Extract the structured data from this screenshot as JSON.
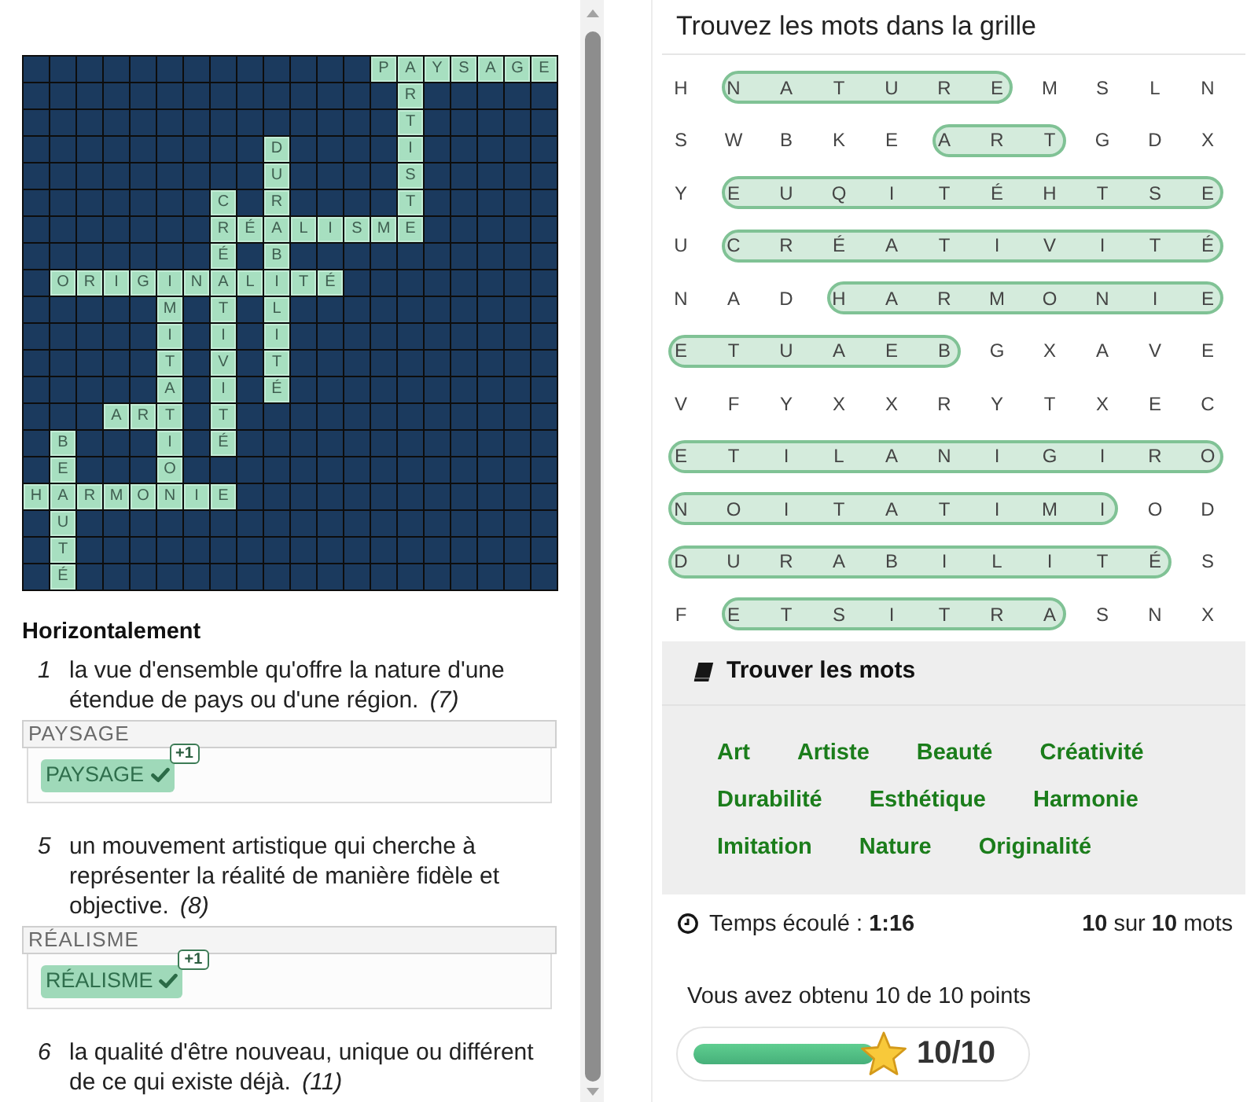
{
  "crossword": {
    "rows": [
      [
        null,
        null,
        null,
        null,
        null,
        null,
        null,
        null,
        null,
        null,
        null,
        null,
        null,
        "P",
        "A",
        "Y",
        "S",
        "A",
        "G",
        "E"
      ],
      [
        null,
        null,
        null,
        null,
        null,
        null,
        null,
        null,
        null,
        null,
        null,
        null,
        null,
        null,
        "R",
        null,
        null,
        null,
        null,
        null
      ],
      [
        null,
        null,
        null,
        null,
        null,
        null,
        null,
        null,
        null,
        null,
        null,
        null,
        null,
        null,
        "T",
        null,
        null,
        null,
        null,
        null
      ],
      [
        null,
        null,
        null,
        null,
        null,
        null,
        null,
        null,
        null,
        "D",
        null,
        null,
        null,
        null,
        "I",
        null,
        null,
        null,
        null,
        null
      ],
      [
        null,
        null,
        null,
        null,
        null,
        null,
        null,
        null,
        null,
        "U",
        null,
        null,
        null,
        null,
        "S",
        null,
        null,
        null,
        null,
        null
      ],
      [
        null,
        null,
        null,
        null,
        null,
        null,
        null,
        "C",
        null,
        "R",
        null,
        null,
        null,
        null,
        "T",
        null,
        null,
        null,
        null,
        null
      ],
      [
        null,
        null,
        null,
        null,
        null,
        null,
        null,
        "R",
        "É",
        "A",
        "L",
        "I",
        "S",
        "M",
        "E",
        null,
        null,
        null,
        null,
        null
      ],
      [
        null,
        null,
        null,
        null,
        null,
        null,
        null,
        "É",
        null,
        "B",
        null,
        null,
        null,
        null,
        null,
        null,
        null,
        null,
        null,
        null
      ],
      [
        null,
        "O",
        "R",
        "I",
        "G",
        "I",
        "N",
        "A",
        "L",
        "I",
        "T",
        "É",
        null,
        null,
        null,
        null,
        null,
        null,
        null,
        null
      ],
      [
        null,
        null,
        null,
        null,
        null,
        "M",
        null,
        "T",
        null,
        "L",
        null,
        null,
        null,
        null,
        null,
        null,
        null,
        null,
        null,
        null
      ],
      [
        null,
        null,
        null,
        null,
        null,
        "I",
        null,
        "I",
        null,
        "I",
        null,
        null,
        null,
        null,
        null,
        null,
        null,
        null,
        null,
        null
      ],
      [
        null,
        null,
        null,
        null,
        null,
        "T",
        null,
        "V",
        null,
        "T",
        null,
        null,
        null,
        null,
        null,
        null,
        null,
        null,
        null,
        null
      ],
      [
        null,
        null,
        null,
        null,
        null,
        "A",
        null,
        "I",
        null,
        "É",
        null,
        null,
        null,
        null,
        null,
        null,
        null,
        null,
        null,
        null
      ],
      [
        null,
        null,
        null,
        "A",
        "R",
        "T",
        null,
        "T",
        null,
        null,
        null,
        null,
        null,
        null,
        null,
        null,
        null,
        null,
        null,
        null
      ],
      [
        null,
        "B",
        null,
        null,
        null,
        "I",
        null,
        "É",
        null,
        null,
        null,
        null,
        null,
        null,
        null,
        null,
        null,
        null,
        null,
        null
      ],
      [
        null,
        "E",
        null,
        null,
        null,
        "O",
        null,
        null,
        null,
        null,
        null,
        null,
        null,
        null,
        null,
        null,
        null,
        null,
        null,
        null
      ],
      [
        "H",
        "A",
        "R",
        "M",
        "O",
        "N",
        "I",
        "E",
        null,
        null,
        null,
        null,
        null,
        null,
        null,
        null,
        null,
        null,
        null,
        null
      ],
      [
        null,
        "U",
        null,
        null,
        null,
        null,
        null,
        null,
        null,
        null,
        null,
        null,
        null,
        null,
        null,
        null,
        null,
        null,
        null,
        null
      ],
      [
        null,
        "T",
        null,
        null,
        null,
        null,
        null,
        null,
        null,
        null,
        null,
        null,
        null,
        null,
        null,
        null,
        null,
        null,
        null,
        null
      ],
      [
        null,
        "É",
        null,
        null,
        null,
        null,
        null,
        null,
        null,
        null,
        null,
        null,
        null,
        null,
        null,
        null,
        null,
        null,
        null,
        null
      ]
    ]
  },
  "clues": {
    "heading": "Horizontalement",
    "items": [
      {
        "number": "1",
        "text": "la vue d'ensemble qu'offre la nature d'une étendue de pays ou d'une région.",
        "length": "(7)",
        "answer_label": "PAYSAGE",
        "answer": "PAYSAGE",
        "correct": true,
        "points": "+1"
      },
      {
        "number": "5",
        "text": "un mouvement artistique qui cherche à représenter la réalité de manière fidèle et objective.",
        "length": "(8)",
        "answer_label": "RÉALISME",
        "answer": "RÉALISME",
        "correct": true,
        "points": "+1"
      },
      {
        "number": "6",
        "text": "la qualité d'être nouveau, unique ou différent de ce qui existe déjà.",
        "length": "(11)"
      }
    ]
  },
  "word_search": {
    "title": "Trouvez les mots dans la grille",
    "rows": [
      [
        {
          "letters": [
            "H"
          ],
          "found": false
        },
        {
          "letters": [
            "N",
            "A",
            "T",
            "U",
            "R",
            "E"
          ],
          "found": true
        },
        {
          "letters": [
            "M",
            "S",
            "L",
            "N"
          ],
          "found": false
        }
      ],
      [
        {
          "letters": [
            "S",
            "W",
            "B",
            "K",
            "E"
          ],
          "found": false
        },
        {
          "letters": [
            "A",
            "R",
            "T"
          ],
          "found": true
        },
        {
          "letters": [
            "G",
            "D",
            "X"
          ],
          "found": false
        }
      ],
      [
        {
          "letters": [
            "Y"
          ],
          "found": false
        },
        {
          "letters": [
            "E",
            "U",
            "Q",
            "I",
            "T",
            "É",
            "H",
            "T",
            "S",
            "E"
          ],
          "found": true
        }
      ],
      [
        {
          "letters": [
            "U"
          ],
          "found": false
        },
        {
          "letters": [
            "C",
            "R",
            "É",
            "A",
            "T",
            "I",
            "V",
            "I",
            "T",
            "É"
          ],
          "found": true
        }
      ],
      [
        {
          "letters": [
            "N",
            "A",
            "D"
          ],
          "found": false
        },
        {
          "letters": [
            "H",
            "A",
            "R",
            "M",
            "O",
            "N",
            "I",
            "E"
          ],
          "found": true
        }
      ],
      [
        {
          "letters": [
            "E",
            "T",
            "U",
            "A",
            "E",
            "B"
          ],
          "found": true
        },
        {
          "letters": [
            "G",
            "X",
            "A",
            "V",
            "E"
          ],
          "found": false
        }
      ],
      [
        {
          "letters": [
            "V",
            "F",
            "Y",
            "X",
            "X",
            "R",
            "Y",
            "T",
            "X",
            "E",
            "C"
          ],
          "found": false
        }
      ],
      [
        {
          "letters": [
            "E",
            "T",
            "I",
            "L",
            "A",
            "N",
            "I",
            "G",
            "I",
            "R",
            "O"
          ],
          "found": true
        }
      ],
      [
        {
          "letters": [
            "N",
            "O",
            "I",
            "T",
            "A",
            "T",
            "I",
            "M",
            "I"
          ],
          "found": true
        },
        {
          "letters": [
            "O",
            "D"
          ],
          "found": false
        }
      ],
      [
        {
          "letters": [
            "D",
            "U",
            "R",
            "A",
            "B",
            "I",
            "L",
            "I",
            "T",
            "É"
          ],
          "found": true
        },
        {
          "letters": [
            "S"
          ],
          "found": false
        }
      ],
      [
        {
          "letters": [
            "F"
          ],
          "found": false
        },
        {
          "letters": [
            "E",
            "T",
            "S",
            "I",
            "T",
            "R",
            "A"
          ],
          "found": true
        },
        {
          "letters": [
            "S",
            "N",
            "X"
          ],
          "found": false
        }
      ]
    ]
  },
  "word_list": {
    "title": "Trouver les mots",
    "words": [
      {
        "text": "Art",
        "found": true
      },
      {
        "text": "Artiste",
        "found": true
      },
      {
        "text": "Beauté",
        "found": true
      },
      {
        "text": "Créativité",
        "found": true
      },
      {
        "text": "Durabilité",
        "found": true
      },
      {
        "text": "Esthétique",
        "found": true
      },
      {
        "text": "Harmonie",
        "found": true
      },
      {
        "text": "Imitation",
        "found": true
      },
      {
        "text": "Nature",
        "found": true
      },
      {
        "text": "Originalité",
        "found": true
      }
    ]
  },
  "status": {
    "elapsed": "Temps écoulé : **1:16**",
    "count": "**10** sur **10** mots"
  },
  "score": {
    "message": "Vous avez obtenu 10 de 10 points",
    "level": 1,
    "value": "10/10"
  }
}
